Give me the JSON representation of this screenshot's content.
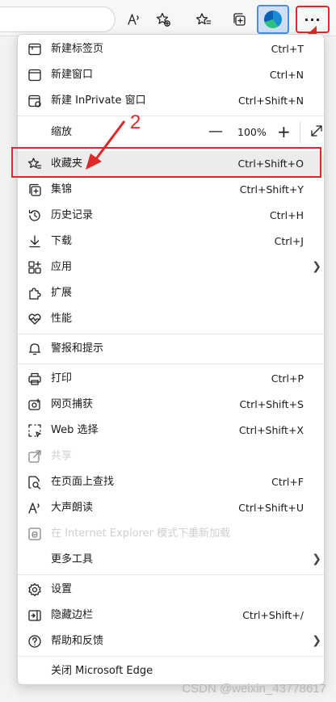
{
  "menu": {
    "items": [
      {
        "key": "new-tab",
        "label": "新建标签页",
        "shortcut": "Ctrl+T"
      },
      {
        "key": "new-window",
        "label": "新建窗口",
        "shortcut": "Ctrl+N"
      },
      {
        "key": "new-inprivate",
        "label": "新建 InPrivate 窗口",
        "shortcut": "Ctrl+Shift+N"
      },
      {
        "key": "favorites",
        "label": "收藏夹",
        "shortcut": "Ctrl+Shift+O"
      },
      {
        "key": "collections",
        "label": "集锦",
        "shortcut": "Ctrl+Shift+Y"
      },
      {
        "key": "history",
        "label": "历史记录",
        "shortcut": "Ctrl+H"
      },
      {
        "key": "downloads",
        "label": "下载",
        "shortcut": "Ctrl+J"
      },
      {
        "key": "apps",
        "label": "应用",
        "shortcut": ""
      },
      {
        "key": "extensions",
        "label": "扩展",
        "shortcut": ""
      },
      {
        "key": "performance",
        "label": "性能",
        "shortcut": ""
      },
      {
        "key": "alerts",
        "label": "警报和提示",
        "shortcut": ""
      },
      {
        "key": "print",
        "label": "打印",
        "shortcut": "Ctrl+P"
      },
      {
        "key": "web-capture",
        "label": "网页捕获",
        "shortcut": "Ctrl+Shift+S"
      },
      {
        "key": "web-select",
        "label": "Web 选择",
        "shortcut": "Ctrl+Shift+X"
      },
      {
        "key": "share",
        "label": "共享",
        "shortcut": ""
      },
      {
        "key": "find",
        "label": "在页面上查找",
        "shortcut": "Ctrl+F"
      },
      {
        "key": "read-aloud",
        "label": "大声朗读",
        "shortcut": "Ctrl+Shift+U"
      },
      {
        "key": "ie-mode",
        "label": "在 Internet Explorer 模式下重新加载",
        "shortcut": ""
      },
      {
        "key": "more-tools",
        "label": "更多工具",
        "shortcut": ""
      },
      {
        "key": "settings",
        "label": "设置",
        "shortcut": ""
      },
      {
        "key": "sidebar",
        "label": "隐藏边栏",
        "shortcut": "Ctrl+Shift+/"
      },
      {
        "key": "help",
        "label": "帮助和反馈",
        "shortcut": ""
      },
      {
        "key": "close",
        "label": "关闭 Microsoft Edge",
        "shortcut": ""
      }
    ],
    "zoom": {
      "label": "缩放",
      "minus": "—",
      "value": "100%",
      "plus": "+"
    }
  },
  "annotation": {
    "number": "2"
  },
  "toolbar": {
    "more": "···"
  },
  "watermark": "CSDN @weixin_43778617",
  "colors": {
    "annotation": "#e02828",
    "highlight": "#ececec"
  }
}
